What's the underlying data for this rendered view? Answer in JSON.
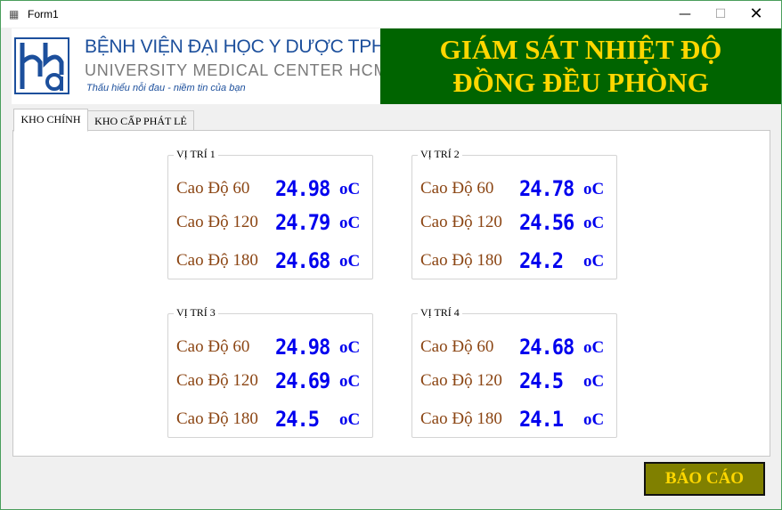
{
  "window": {
    "title": "Form1",
    "icon": "app-icon",
    "minimize": "—",
    "maximize": "☐",
    "close": "✕"
  },
  "logo": {
    "title": "BỆNH VIỆN ĐẠI HỌC Y DƯỢC TPHCM",
    "subtitle": "UNIVERSITY MEDICAL CENTER HCMC",
    "slogan": "Thấu hiểu nỗi đau - niềm tin của bạn"
  },
  "header": {
    "line1": "GIÁM SÁT NHIỆT ĐỘ",
    "line2": "ĐỒNG ĐỀU PHÒNG"
  },
  "tabs": [
    {
      "label": "KHO CHÍNH",
      "active": true
    },
    {
      "label": "KHO CẤP PHÁT LẺ",
      "active": false
    }
  ],
  "positions": [
    {
      "title": "VỊ TRÍ 1",
      "readings": [
        {
          "label": "Cao Độ 60",
          "value": "24.98",
          "unit": "oC"
        },
        {
          "label": "Cao Độ 120",
          "value": "24.79",
          "unit": "oC"
        },
        {
          "label": "Cao Độ 180",
          "value": "24.68",
          "unit": "oC"
        }
      ]
    },
    {
      "title": "VỊ TRÍ 2",
      "readings": [
        {
          "label": "Cao Độ 60",
          "value": "24.78",
          "unit": "oC"
        },
        {
          "label": "Cao Độ 120",
          "value": "24.56",
          "unit": "oC"
        },
        {
          "label": "Cao Độ 180",
          "value": "24.2",
          "unit": "oC"
        }
      ]
    },
    {
      "title": "VỊ TRÍ 3",
      "readings": [
        {
          "label": "Cao Độ 60",
          "value": "24.98",
          "unit": "oC"
        },
        {
          "label": "Cao Độ 120",
          "value": "24.69",
          "unit": "oC"
        },
        {
          "label": "Cao Độ 180",
          "value": "24.5",
          "unit": "oC"
        }
      ]
    },
    {
      "title": "VỊ TRÍ 4",
      "readings": [
        {
          "label": "Cao Độ 60",
          "value": "24.68",
          "unit": "oC"
        },
        {
          "label": "Cao Độ 120",
          "value": "24.5",
          "unit": "oC"
        },
        {
          "label": "Cao Độ 180",
          "value": "24.1",
          "unit": "oC"
        }
      ]
    }
  ],
  "report_button": {
    "label": "BÁO CÁO"
  },
  "colors": {
    "banner_bg": "#006400",
    "banner_text": "#ffd700",
    "reading_label": "#8b4513",
    "reading_value": "#0000ee",
    "button_bg": "#808000",
    "logo_blue": "#1c4f9c"
  }
}
